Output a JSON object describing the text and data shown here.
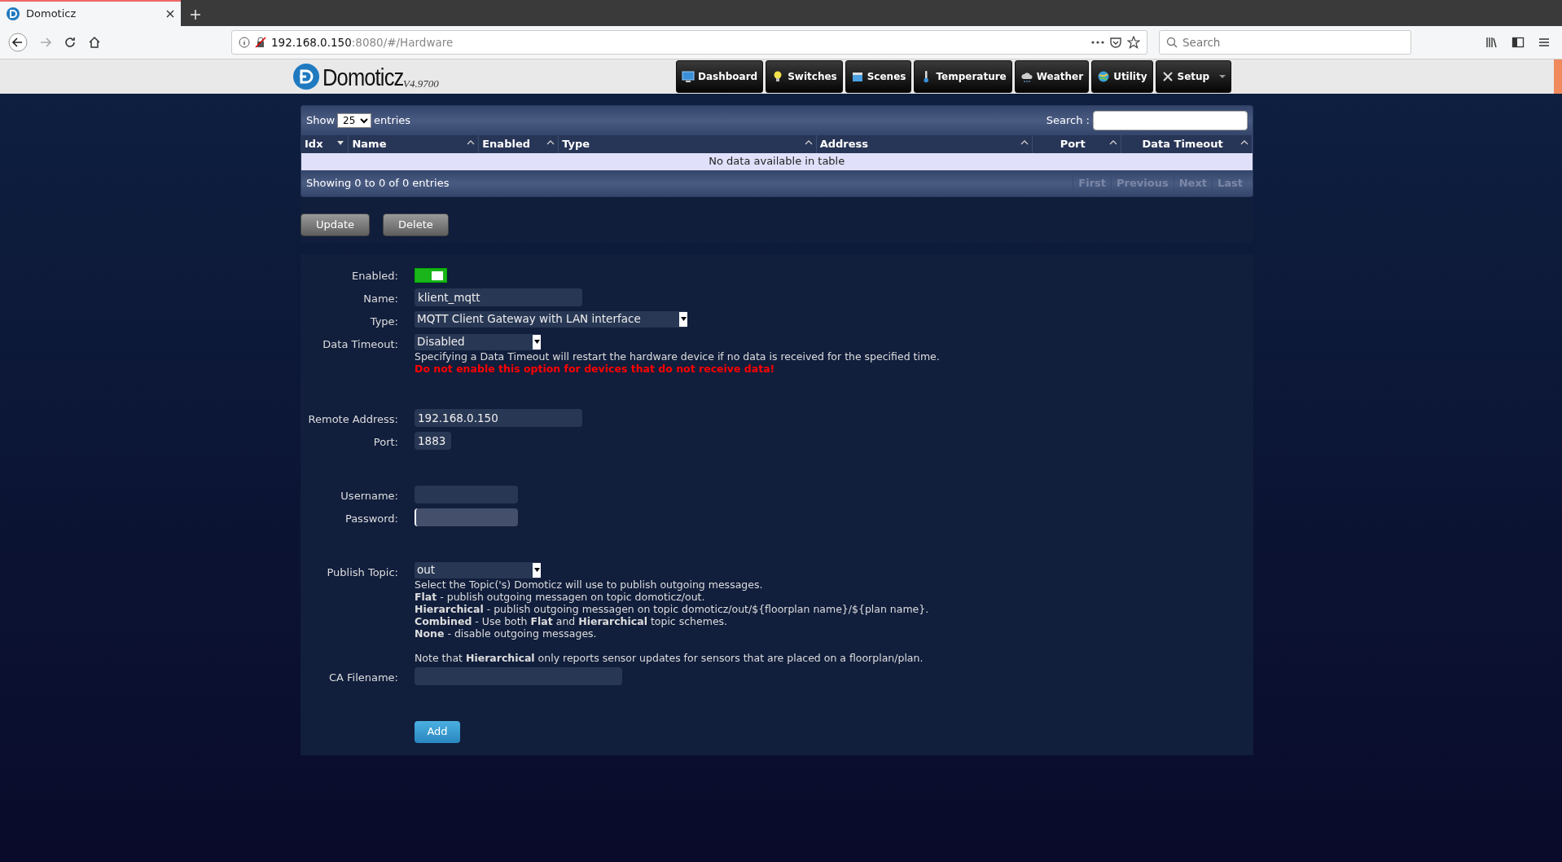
{
  "browser": {
    "tab_title": "Domoticz",
    "url_host": "192.168.0.150",
    "url_rest": ":8080/#/Hardware",
    "search_placeholder": "Search"
  },
  "header": {
    "logo": "Domoticz",
    "version": "V4.9700",
    "nav": [
      {
        "label": "Dashboard",
        "dropdown": false
      },
      {
        "label": "Switches",
        "dropdown": false
      },
      {
        "label": "Scenes",
        "dropdown": false
      },
      {
        "label": "Temperature",
        "dropdown": false
      },
      {
        "label": "Weather",
        "dropdown": false
      },
      {
        "label": "Utility",
        "dropdown": false
      },
      {
        "label": "Setup",
        "dropdown": true
      }
    ]
  },
  "table": {
    "show_label": "Show",
    "page_size": "25",
    "entries_label": "entries",
    "search_label": "Search :",
    "columns": [
      {
        "label": "Idx",
        "sorted": true
      },
      {
        "label": "Name",
        "sorted": false
      },
      {
        "label": "Enabled",
        "sorted": false
      },
      {
        "label": "Type",
        "sorted": false
      },
      {
        "label": "Address",
        "sorted": false
      },
      {
        "label": "Port",
        "sorted": false
      },
      {
        "label": "Data Timeout",
        "sorted": false
      }
    ],
    "empty_message": "No data available in table",
    "info": "Showing 0 to 0 of 0 entries",
    "pager": [
      "First",
      "Previous",
      "Next",
      "Last"
    ]
  },
  "actions": [
    "Update",
    "Delete"
  ],
  "form": {
    "groups": [
      {
        "fields": [
          {
            "kind": "toggle",
            "label": "Enabled:",
            "on": true
          },
          {
            "kind": "text",
            "label": "Name:",
            "value": "klient_mqtt"
          },
          {
            "kind": "select",
            "label": "Type:",
            "value": "MQTT Client Gateway with LAN interface"
          },
          {
            "kind": "select",
            "label": "Data Timeout:",
            "value": "Disabled",
            "notes": [
              {
                "kind": "info",
                "text": "Specifying a Data Timeout will restart the hardware device if no data is received for the specified time."
              },
              {
                "kind": "warning",
                "text": "Do not enable this option for devices that do not receive data!"
              }
            ]
          }
        ]
      },
      {
        "fields": [
          {
            "kind": "text",
            "label": "Remote Address:",
            "value": "192.168.0.150"
          },
          {
            "kind": "text",
            "label": "Port:",
            "value": "1883"
          }
        ]
      },
      {
        "fields": [
          {
            "kind": "text",
            "label": "Username:",
            "focused": false
          },
          {
            "kind": "password",
            "label": "Password:",
            "focused": true
          }
        ]
      },
      {
        "fields": [
          {
            "kind": "select",
            "label": "Publish Topic:",
            "value": "out",
            "help": [
              [
                "Select the Topic('s) Domoticz will use to publish outgoing messages.",
                "**Flat** - publish outgoing messagen on topic domoticz/out.",
                "**Hierarchical** - publish outgoing messagen on topic domoticz/out/${floorplan name}/${plan name}.",
                "**Combined** - Use both **Flat** and **Hierarchical** topic schemes.",
                "**None** - disable outgoing messages."
              ],
              [
                "Note that **Hierarchical** only reports sensor updates for sensors that are placed on a floorplan/plan."
              ]
            ]
          },
          {
            "kind": "text",
            "label": "CA Filename:"
          }
        ]
      }
    ],
    "submit": "Add"
  }
}
